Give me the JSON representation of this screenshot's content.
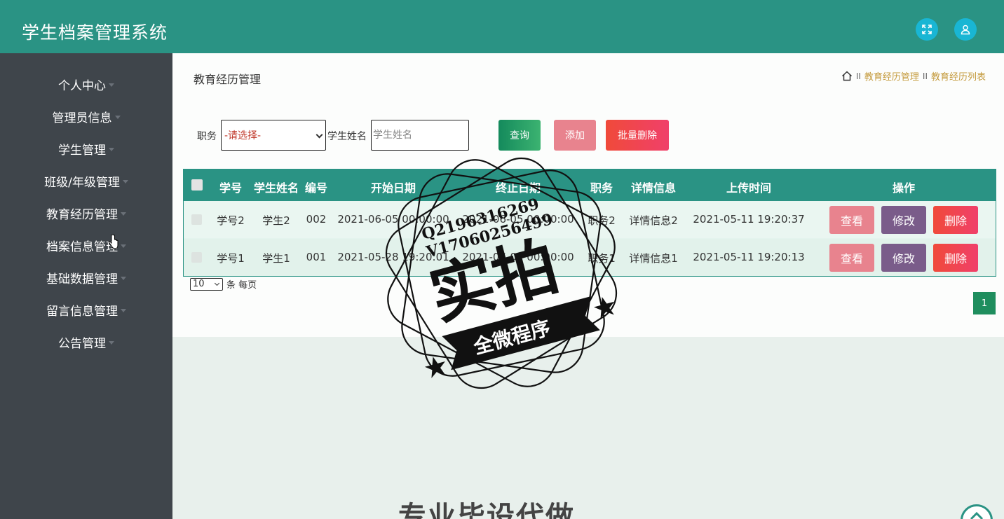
{
  "header": {
    "app_title": "学生档案管理系统",
    "fullscreen_icon": "fullscreen-icon",
    "user_icon": "user-icon",
    "accent_color": "#2a9384"
  },
  "sidebar": {
    "items": [
      {
        "label": "个人中心"
      },
      {
        "label": "管理员信息"
      },
      {
        "label": "学生管理"
      },
      {
        "label": "班级/年级管理"
      },
      {
        "label": "教育经历管理"
      },
      {
        "label": "档案信息管理"
      },
      {
        "label": "基础数据管理"
      },
      {
        "label": "留言信息管理"
      },
      {
        "label": "公告管理"
      }
    ]
  },
  "page": {
    "title": "教育经历管理",
    "breadcrumb": [
      "教育经历管理",
      "教育经历列表"
    ],
    "breadcrumb_sep": "II"
  },
  "filters": {
    "position_label": "职务",
    "position_value": "-请选择-",
    "name_label": "学生姓名",
    "name_placeholder": "学生姓名",
    "query_label": "查询",
    "add_label": "添加",
    "batch_delete_label": "批量删除"
  },
  "table": {
    "headers": [
      "学号",
      "学生姓名",
      "编号",
      "开始日期",
      "终止日期",
      "职务",
      "详情信息",
      "上传时间",
      "操作"
    ],
    "rows": [
      {
        "student_no": "学号2",
        "name": "学生2",
        "code": "002",
        "start": "2021-06-05 00:00:00",
        "end": "2021-06-05 00:00:00",
        "position": "职务2",
        "detail": "详情信息2",
        "upload": "2021-05-11 19:20:37"
      },
      {
        "student_no": "学号1",
        "name": "学生1",
        "code": "001",
        "start": "2021-05-28 19:20:01",
        "end": "2021-06-01 00:00:00",
        "position": "职务1",
        "detail": "详情信息1",
        "upload": "2021-05-11 19:20:13"
      }
    ],
    "actions": {
      "view": "查看",
      "edit": "修改",
      "delete": "删除"
    }
  },
  "pagination": {
    "page_size": "10",
    "page_size_suffix": "条 每页",
    "current_page": "1"
  },
  "watermark": {
    "line1": "Q2196316269",
    "line2": "V17060256499",
    "big": "实拍",
    "banner": "全微程序"
  },
  "footer_text": "专业毕设代做"
}
